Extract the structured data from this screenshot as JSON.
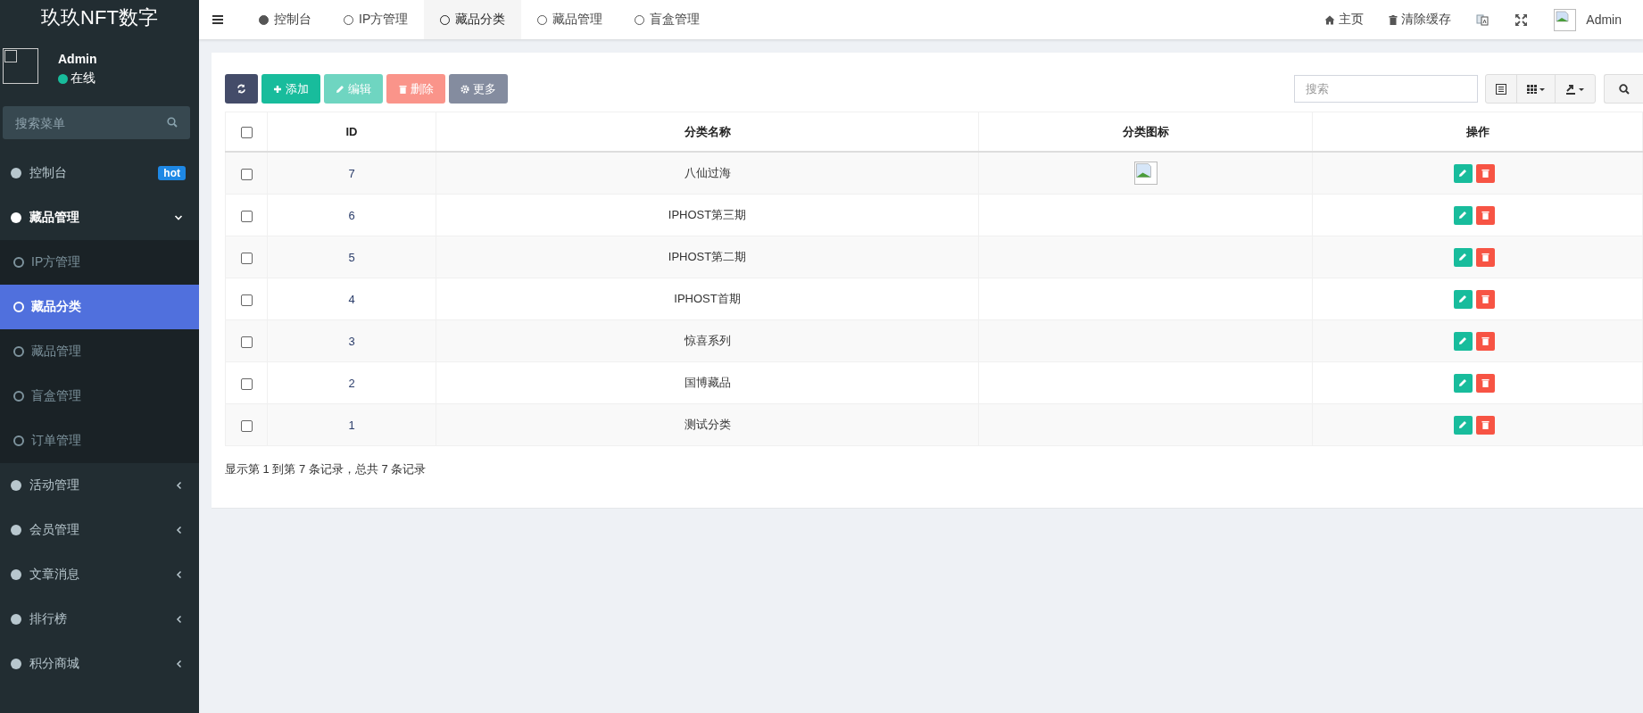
{
  "sidebar": {
    "brand": "玖玖NFT数字",
    "user": {
      "name": "Admin",
      "status": "在线",
      "online": true
    },
    "search": {
      "placeholder": "搜索菜单"
    },
    "menu": [
      {
        "label": "控制台",
        "kind": "link",
        "badge": "hot",
        "selected": false
      },
      {
        "label": "藏品管理",
        "kind": "group",
        "expanded": true,
        "children": [
          {
            "label": "IP方管理",
            "selected": false
          },
          {
            "label": "藏品分类",
            "selected": true
          },
          {
            "label": "藏品管理",
            "selected": false
          },
          {
            "label": "盲盒管理",
            "selected": false
          },
          {
            "label": "订单管理",
            "selected": false
          }
        ]
      },
      {
        "label": "活动管理",
        "kind": "group",
        "expanded": false
      },
      {
        "label": "会员管理",
        "kind": "group",
        "expanded": false
      },
      {
        "label": "文章消息",
        "kind": "group",
        "expanded": false
      },
      {
        "label": "排行榜",
        "kind": "group",
        "expanded": false
      },
      {
        "label": "积分商城",
        "kind": "group",
        "expanded": false
      }
    ]
  },
  "tabs": [
    {
      "label": "控制台",
      "kind": "dashboard",
      "selected": false
    },
    {
      "label": "IP方管理",
      "kind": "page",
      "selected": false
    },
    {
      "label": "藏品分类",
      "kind": "page",
      "selected": true
    },
    {
      "label": "藏品管理",
      "kind": "page",
      "selected": false
    },
    {
      "label": "盲盒管理",
      "kind": "page",
      "selected": false
    }
  ],
  "top_links": [
    {
      "label": "主页",
      "kind": "home"
    },
    {
      "label": "清除缓存",
      "kind": "trash"
    }
  ],
  "top_user": "Admin",
  "toolbar": [
    {
      "kind": "refresh",
      "disabled": false
    },
    {
      "kind": "add",
      "label": "添加",
      "disabled": false
    },
    {
      "kind": "edit",
      "label": "编辑",
      "disabled": true
    },
    {
      "kind": "delete",
      "label": "删除",
      "disabled": true
    },
    {
      "kind": "more",
      "label": "更多",
      "disabled": false
    }
  ],
  "table_search": {
    "placeholder": "搜索"
  },
  "table": {
    "select_all_checked": false,
    "columns": [
      "ID",
      "分类名称",
      "分类图标",
      "操作"
    ],
    "rows": [
      {
        "checked": false,
        "id": "7",
        "name": "八仙过海",
        "has_icon": true
      },
      {
        "checked": false,
        "id": "6",
        "name": "IPHOST第三期",
        "has_icon": false
      },
      {
        "checked": false,
        "id": "5",
        "name": "IPHOST第二期",
        "has_icon": false
      },
      {
        "checked": false,
        "id": "4",
        "name": "IPHOST首期",
        "has_icon": false
      },
      {
        "checked": false,
        "id": "3",
        "name": "惊喜系列",
        "has_icon": false
      },
      {
        "checked": false,
        "id": "2",
        "name": "国博藏品",
        "has_icon": false
      },
      {
        "checked": false,
        "id": "1",
        "name": "测试分类",
        "has_icon": false
      }
    ]
  },
  "pagination_info": "显示第 1 到第 7 条记录，总共 7 条记录"
}
